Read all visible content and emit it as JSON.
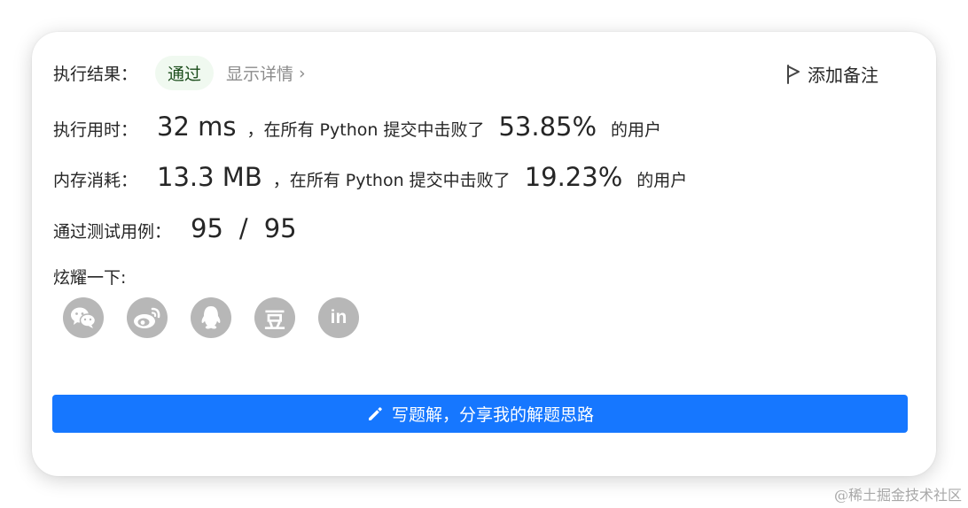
{
  "result": {
    "label": "执行结果：",
    "status": "通过",
    "detail_link": "显示详情",
    "detail_arrow": "›",
    "add_note": "添加备注"
  },
  "runtime": {
    "label": "执行用时：",
    "value": "32 ms",
    "mid_text": "，在所有 Python 提交中击败了",
    "percent": "53.85%",
    "suffix": "的用户"
  },
  "memory": {
    "label": "内存消耗：",
    "value": "13.3 MB",
    "mid_text": "，在所有 Python 提交中击败了",
    "percent": "19.23%",
    "suffix": "的用户"
  },
  "testcases": {
    "label": "通过测试用例：",
    "passed": "95",
    "separator": "/",
    "total": "95"
  },
  "share": {
    "label": "炫耀一下:",
    "icons": [
      "wechat-icon",
      "weibo-icon",
      "qq-icon",
      "douban-icon",
      "linkedin-icon"
    ],
    "douban_glyph": "豆",
    "linkedin_glyph": "in"
  },
  "write_solution": {
    "label": "写题解，分享我的解题思路"
  },
  "watermark": "@稀土掘金技术社区",
  "colors": {
    "accent": "#1677ff",
    "pass_badge_bg": "#f0f9f0",
    "share_icon_bg": "#b7b7b7",
    "muted_text": "#8c8c8c"
  }
}
